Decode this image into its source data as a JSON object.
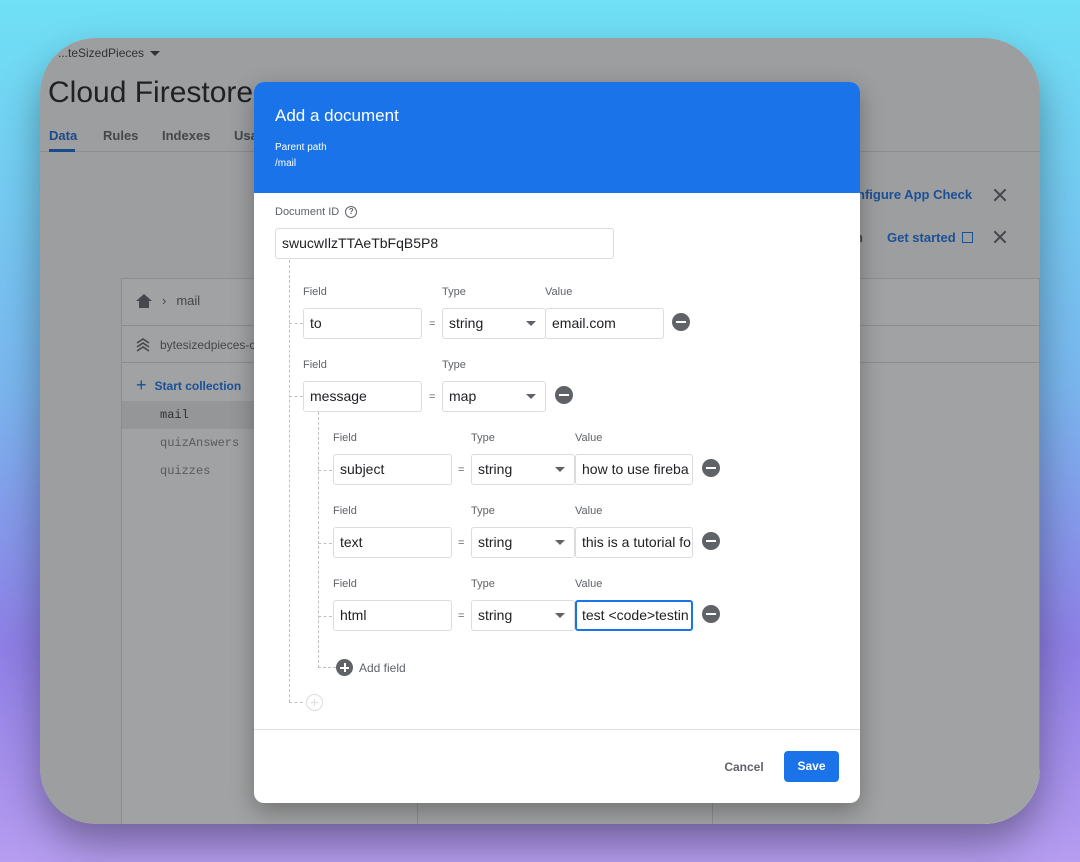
{
  "console": {
    "project_name": "...teSizedPieces",
    "page_title": "Cloud Firestore",
    "tabs": [
      "Data",
      "Rules",
      "Indexes",
      "Usa"
    ],
    "banner_link_1": "nfigure App Check",
    "banner_link_2_prefix": "n",
    "banner_link_2": "Get started",
    "breadcrumb": "mail",
    "database": "bytesizedpieces-c",
    "start_collection": "Start collection",
    "collections": [
      "mail",
      "quizAnswers",
      "quizzes"
    ]
  },
  "dialog": {
    "title": "Add a document",
    "parent_path_label": "Parent path",
    "parent_path": "/mail",
    "document_id_label": "Document ID",
    "document_id": "swucwIlzTTAeTbFqB5P8",
    "field_label": "Field",
    "type_label": "Type",
    "value_label": "Value",
    "equals": "=",
    "fields": [
      {
        "name": "to",
        "type": "string",
        "value": "email.com"
      },
      {
        "name": "message",
        "type": "map"
      }
    ],
    "map_fields": [
      {
        "name": "subject",
        "type": "string",
        "value": "how to use fireba"
      },
      {
        "name": "text",
        "type": "string",
        "value": "this is a tutorial fo"
      },
      {
        "name": "html",
        "type": "string",
        "value": "test <code>testin"
      }
    ],
    "add_field": "Add field",
    "cancel": "Cancel",
    "save": "Save"
  }
}
